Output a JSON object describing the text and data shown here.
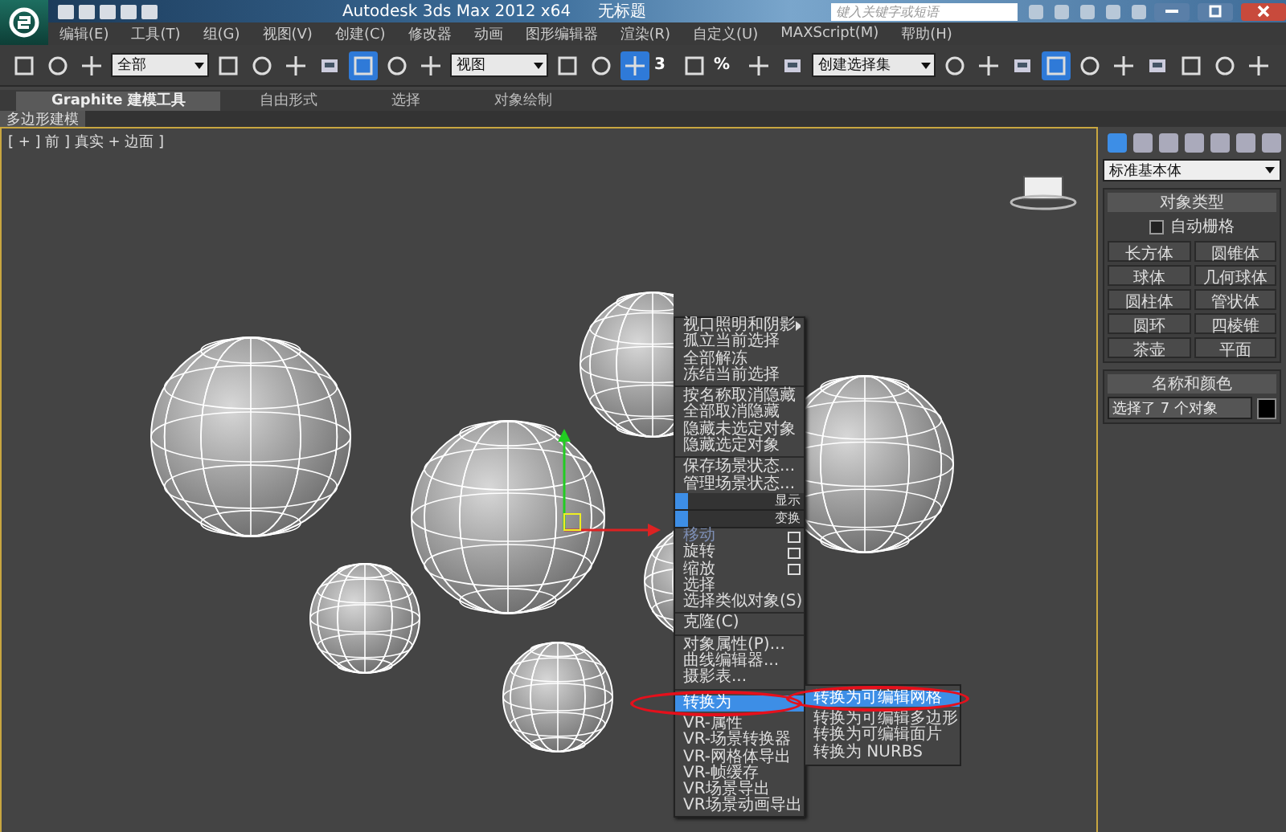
{
  "window": {
    "title": "Autodesk 3ds Max  2012 x64",
    "document": "无标题",
    "search": {
      "placeholder": "键入关键字或短语"
    }
  },
  "menu": [
    "编辑(E)",
    "工具(T)",
    "组(G)",
    "视图(V)",
    "创建(C)",
    "修改器",
    "动画",
    "图形编辑器",
    "渲染(R)",
    "自定义(U)",
    "MAXScript(M)",
    "帮助(H)"
  ],
  "toolbar": [
    {
      "kind": "icon",
      "selected": false
    },
    {
      "kind": "icon",
      "selected": false
    },
    {
      "kind": "icon",
      "selected": false
    },
    {
      "kind": "dropdown",
      "value": "全部"
    },
    {
      "kind": "icon",
      "selected": false
    },
    {
      "kind": "icon",
      "selected": false
    },
    {
      "kind": "icon",
      "selected": false
    },
    {
      "kind": "icon",
      "selected": false
    },
    {
      "kind": "icon",
      "selected": true
    },
    {
      "kind": "icon",
      "selected": false
    },
    {
      "kind": "icon",
      "selected": false
    },
    {
      "kind": "dropdown",
      "value": "视图"
    },
    {
      "kind": "icon",
      "selected": false
    },
    {
      "kind": "icon",
      "selected": false
    },
    {
      "kind": "icon",
      "selected": true
    },
    {
      "kind": "snap",
      "label": "3"
    },
    {
      "kind": "icon",
      "selected": false
    },
    {
      "kind": "snap",
      "label": "%"
    },
    {
      "kind": "icon",
      "selected": false
    },
    {
      "kind": "icon",
      "selected": false
    },
    {
      "kind": "dropdown",
      "value": "创建选择集"
    },
    {
      "kind": "icon",
      "selected": false
    },
    {
      "kind": "icon",
      "selected": false
    },
    {
      "kind": "icon",
      "selected": false
    },
    {
      "kind": "icon",
      "selected": true
    },
    {
      "kind": "icon",
      "selected": false
    },
    {
      "kind": "icon",
      "selected": false
    },
    {
      "kind": "icon",
      "selected": false
    },
    {
      "kind": "icon",
      "selected": false
    },
    {
      "kind": "icon",
      "selected": false
    },
    {
      "kind": "icon",
      "selected": false
    }
  ],
  "ribbon": {
    "tabs": [
      {
        "label": "Graphite 建模工具",
        "selected": true
      },
      {
        "label": "自由形式",
        "selected": false
      },
      {
        "label": "选择",
        "selected": false
      },
      {
        "label": "对象绘制",
        "selected": false
      }
    ],
    "panel": "多边形建模"
  },
  "viewport": {
    "label": "[ + ] 前 ] 真实 + 边面 ]"
  },
  "context_menu": [
    {
      "kind": "item",
      "label": "视口照明和阴影",
      "submenu": true
    },
    {
      "kind": "item",
      "label": "孤立当前选择"
    },
    {
      "kind": "item",
      "label": "全部解冻"
    },
    {
      "kind": "item",
      "label": "冻结当前选择"
    },
    {
      "kind": "separator"
    },
    {
      "kind": "item",
      "label": "按名称取消隐藏"
    },
    {
      "kind": "item",
      "label": "全部取消隐藏"
    },
    {
      "kind": "item",
      "label": "隐藏未选定对象"
    },
    {
      "kind": "item",
      "label": "隐藏选定对象"
    },
    {
      "kind": "separator"
    },
    {
      "kind": "item",
      "label": "保存场景状态..."
    },
    {
      "kind": "item",
      "label": "管理场景状态..."
    },
    {
      "kind": "header",
      "label": "显示"
    },
    {
      "kind": "header",
      "label": "变换"
    },
    {
      "kind": "item",
      "label": "移动",
      "options": true,
      "disabled": true
    },
    {
      "kind": "item",
      "label": "旋转",
      "options": true
    },
    {
      "kind": "item",
      "label": "缩放",
      "options": true
    },
    {
      "kind": "item",
      "label": "选择"
    },
    {
      "kind": "item",
      "label": "选择类似对象(S)"
    },
    {
      "kind": "separator"
    },
    {
      "kind": "item",
      "label": "克隆(C)"
    },
    {
      "kind": "separator"
    },
    {
      "kind": "item",
      "label": "对象属性(P)..."
    },
    {
      "kind": "item",
      "label": "曲线编辑器..."
    },
    {
      "kind": "item",
      "label": "摄影表..."
    },
    {
      "kind": "separator"
    },
    {
      "kind": "item",
      "label": "转换为",
      "selected": true
    },
    {
      "kind": "item",
      "label": "VR-属性"
    },
    {
      "kind": "item",
      "label": "VR-场景转换器"
    },
    {
      "kind": "item",
      "label": "VR-网格体导出"
    },
    {
      "kind": "item",
      "label": "VR-帧缓存"
    },
    {
      "kind": "item",
      "label": "VR场景导出"
    },
    {
      "kind": "item",
      "label": "VR场景动画导出"
    }
  ],
  "submenu": [
    {
      "label": "转换为可编辑网格",
      "selected": true
    },
    {
      "label": "转换为可编辑多边形",
      "selected": false
    },
    {
      "label": "转换为可编辑面片",
      "selected": false
    },
    {
      "label": "转换为 NURBS",
      "selected": false
    }
  ],
  "command_panel": {
    "category": "标准基本体",
    "object_type": {
      "title": "对象类型",
      "autogrid": {
        "label": "自动栅格",
        "checked": false
      },
      "buttons": [
        "长方体",
        "圆锥体",
        "球体",
        "几何球体",
        "圆柱体",
        "管状体",
        "圆环",
        "四棱锥",
        "茶壶",
        "平面"
      ]
    },
    "name_color": {
      "title": "名称和颜色",
      "value": "选择了 7 个对象",
      "color": "#000000"
    }
  }
}
